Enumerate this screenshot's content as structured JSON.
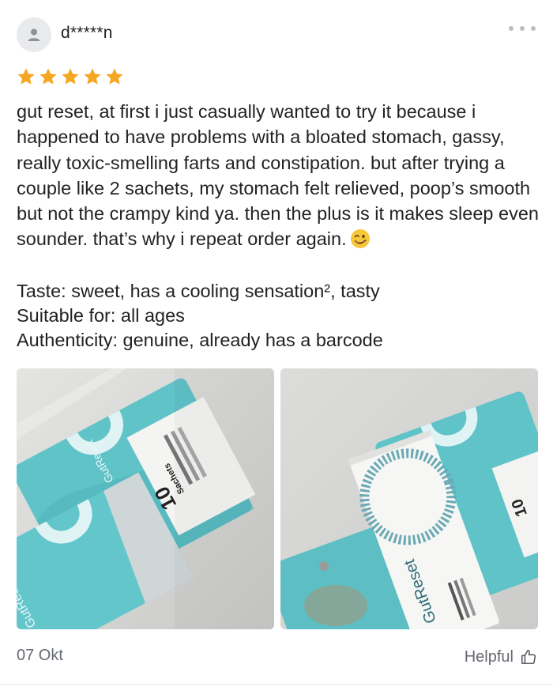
{
  "review": {
    "username": "d*****n",
    "rating": 5,
    "rating_max": 5,
    "body": "gut reset, at first i just casually wanted to try it because i happened to have problems with a bloated stomach, gassy, really toxic-smelling farts and constipation. but after trying a couple like 2 sachets, my stomach felt relieved, poop’s smooth but not the crampy kind ya. then the plus is it makes sleep even sounder. that’s why i repeat order again.",
    "emoji": "winking-face-emoji",
    "attributes": [
      "Taste: sweet, has a cooling sensation², tasty",
      "Suitable for: all ages",
      "Authenticity: genuine, already has a barcode"
    ],
    "photos": [
      {
        "brand": "GutReset",
        "sachet_count": "10",
        "sachet_label": "Sachets"
      },
      {
        "brand": "GutReset",
        "sachet_count": "10"
      }
    ],
    "date": "07 Okt",
    "helpful_label": "Helpful"
  },
  "colors": {
    "star": "#f5a623",
    "text": "#222222",
    "muted": "#666a70",
    "avatar_bg": "#e9eaec",
    "package_teal": "#5fc3c8"
  },
  "icons": {
    "avatar": "user-icon",
    "more": "more-dots-icon",
    "star": "star-icon",
    "helpful": "thumbs-up-icon"
  }
}
